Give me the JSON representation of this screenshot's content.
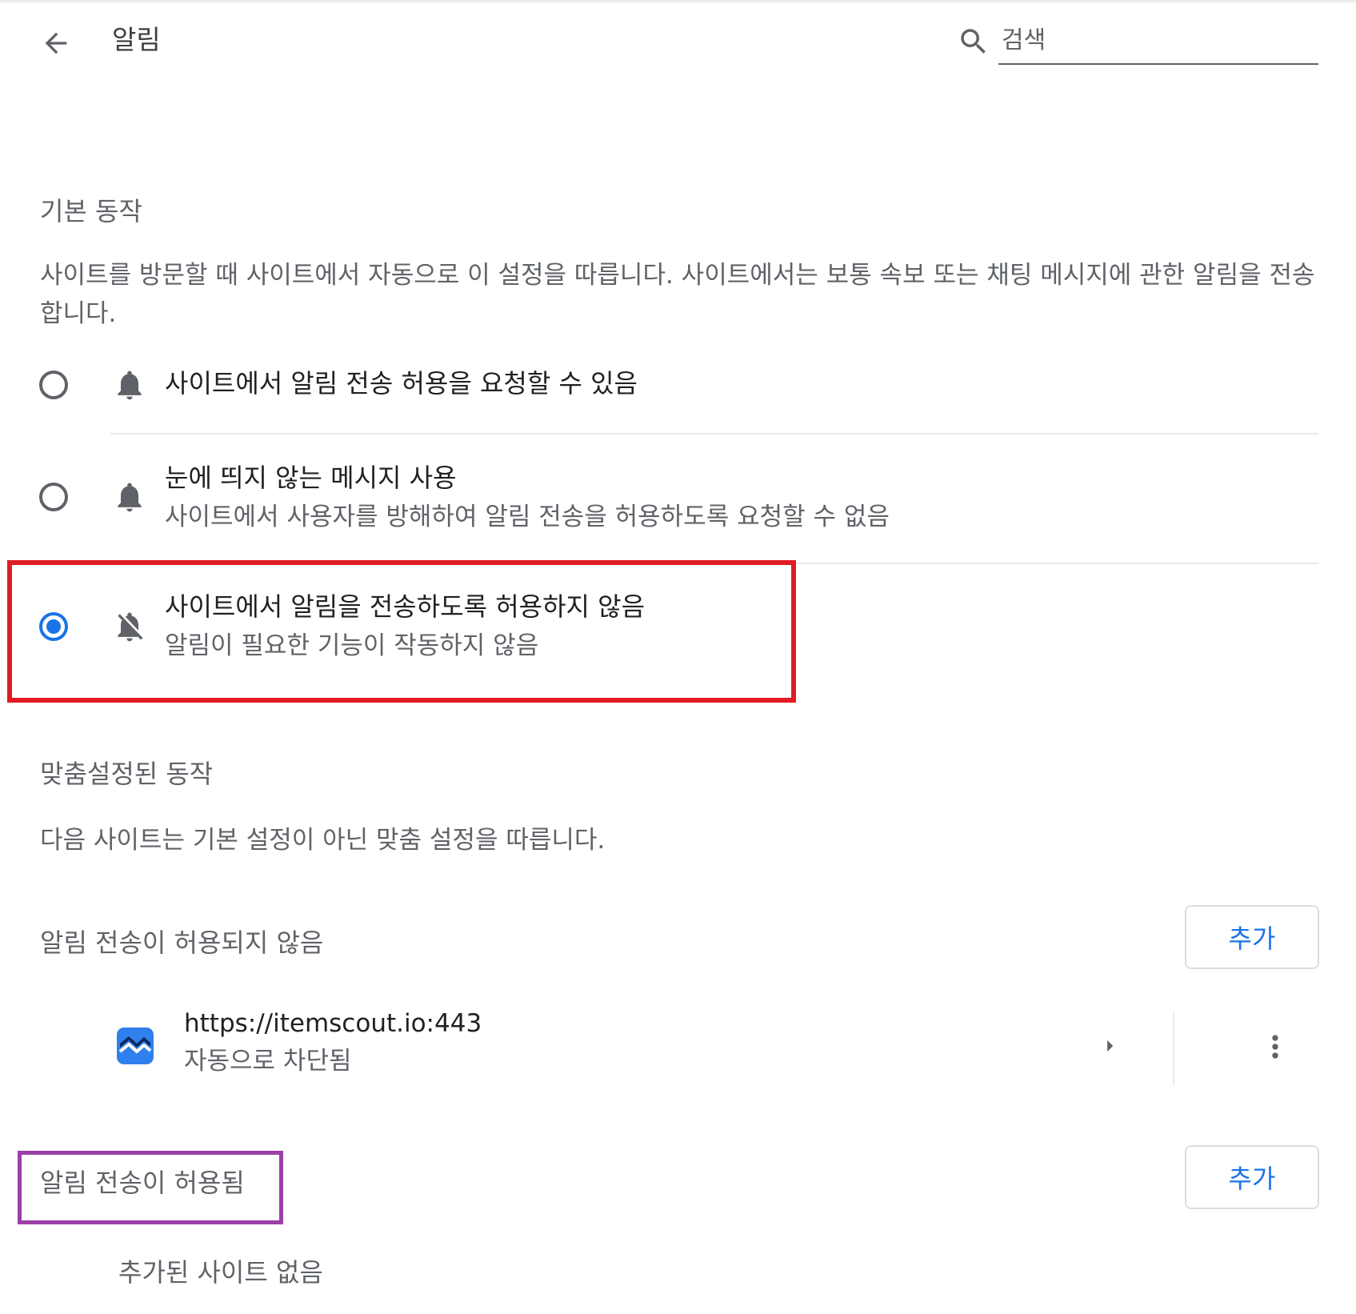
{
  "header": {
    "title": "알림",
    "search_placeholder": "검색"
  },
  "default_behavior": {
    "heading": "기본 동작",
    "description": "사이트를 방문할 때 사이트에서 자동으로 이 설정을 따릅니다. 사이트에서는 보통 속보 또는 채팅 메시지에 관한 알림을 전송합니다.",
    "options": [
      {
        "label": "사이트에서 알림 전송 허용을 요청할 수 있음",
        "sublabel": "",
        "icon": "bell-icon",
        "checked": false
      },
      {
        "label": "눈에 띄지 않는 메시지 사용",
        "sublabel": "사이트에서 사용자를 방해하여 알림 전송을 허용하도록 요청할 수 없음",
        "icon": "bell-icon",
        "checked": false
      },
      {
        "label": "사이트에서 알림을 전송하도록 허용하지 않음",
        "sublabel": "알림이 필요한 기능이 작동하지 않음",
        "icon": "bell-off-icon",
        "checked": true
      }
    ]
  },
  "custom_behavior": {
    "heading": "맞춤설정된 동작",
    "description": "다음 사이트는 기본 설정이 아닌 맞춤 설정을 따릅니다."
  },
  "blocked": {
    "heading": "알림 전송이 허용되지 않음",
    "add_label": "추가",
    "sites": [
      {
        "url": "https://itemscout.io:443",
        "status": "자동으로 차단됨",
        "icon": "itemscout-favicon"
      }
    ]
  },
  "allowed": {
    "heading": "알림 전송이 허용됨",
    "add_label": "추가",
    "empty_text": "추가된 사이트 없음"
  },
  "colors": {
    "accent": "#1a73e8",
    "red_highlight": "#e01b24",
    "purple_highlight": "#9c3fa6"
  }
}
